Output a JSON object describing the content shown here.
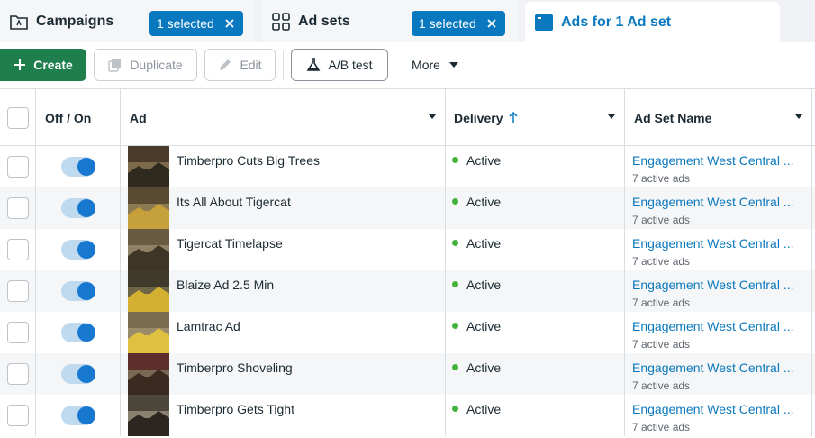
{
  "tabs": [
    {
      "label": "Campaigns",
      "chip": "1 selected",
      "icon": "folder-icon"
    },
    {
      "label": "Ad sets",
      "chip": "1 selected",
      "icon": "grid-icon"
    },
    {
      "label": "Ads for 1 Ad set",
      "icon": "ad-window-icon"
    }
  ],
  "toolbar": {
    "create": "Create",
    "duplicate": "Duplicate",
    "edit": "Edit",
    "ab_test": "A/B test",
    "more": "More"
  },
  "table": {
    "headers": {
      "toggle": "Off / On",
      "ad": "Ad",
      "delivery": "Delivery",
      "adset": "Ad Set Name"
    },
    "rows": [
      {
        "name": "Timberpro Cuts Big Trees",
        "status": "Active",
        "adset": "Engagement West Central ...",
        "sub": "7 active ads",
        "on": true
      },
      {
        "name": "Its All About Tigercat",
        "status": "Active",
        "adset": "Engagement West Central ...",
        "sub": "7 active ads",
        "on": true
      },
      {
        "name": "Tigercat Timelapse",
        "status": "Active",
        "adset": "Engagement West Central ...",
        "sub": "7 active ads",
        "on": true
      },
      {
        "name": "Blaize Ad 2.5 Min",
        "status": "Active",
        "adset": "Engagement West Central ...",
        "sub": "7 active ads",
        "on": true
      },
      {
        "name": "Lamtrac Ad",
        "status": "Active",
        "adset": "Engagement West Central ...",
        "sub": "7 active ads",
        "on": true
      },
      {
        "name": "Timberpro Shoveling",
        "status": "Active",
        "adset": "Engagement West Central ...",
        "sub": "7 active ads",
        "on": true
      },
      {
        "name": "Timberpro Gets Tight",
        "status": "Active",
        "adset": "Engagement West Central ...",
        "sub": "7 active ads",
        "on": true
      }
    ]
  },
  "colors": {
    "accent": "#0a78be",
    "create_green": "#1f7f4c",
    "active_green": "#44b33a",
    "toggle_on": "#1877cf"
  }
}
